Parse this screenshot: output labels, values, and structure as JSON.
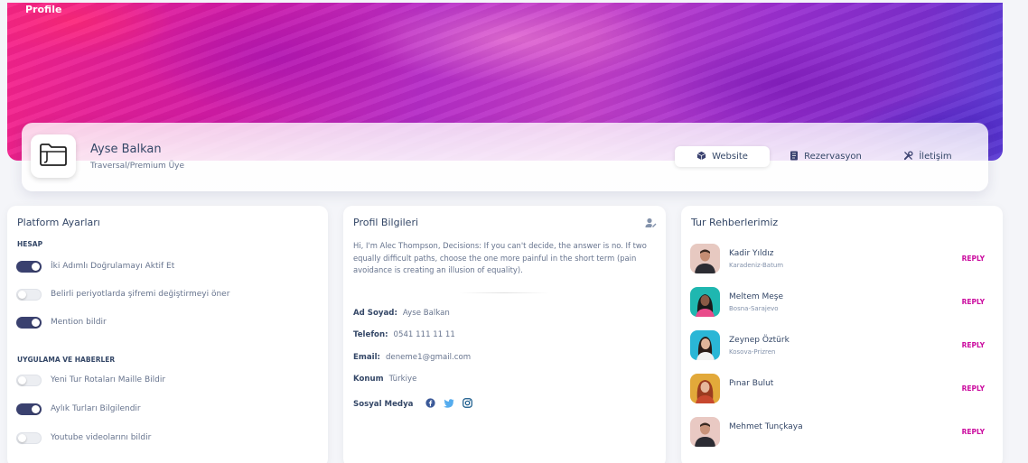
{
  "hero": {
    "title": "Profile"
  },
  "profile": {
    "name": "Ayse Balkan",
    "subtitle": "Traversal/Premium Üye",
    "avatar_icon": "folder-icon",
    "tabs": [
      {
        "label": "Website",
        "icon": "cube-icon",
        "active": true
      },
      {
        "label": "Rezervasyon",
        "icon": "document-icon",
        "active": false
      },
      {
        "label": "İletişim",
        "icon": "tools-icon",
        "active": false
      }
    ]
  },
  "settings": {
    "title": "Platform Ayarları",
    "sections": [
      {
        "label": "HESAP",
        "items": [
          {
            "label": "İki Adımlı Doğrulamayı Aktif Et",
            "on": true
          },
          {
            "label": "Belirli periyotlarda şifremi değiştirmeyi öner",
            "on": false
          },
          {
            "label": "Mention bildir",
            "on": true
          }
        ]
      },
      {
        "label": "UYGULAMA VE HABERLER",
        "items": [
          {
            "label": "Yeni Tur Rotaları Maille Bildir",
            "on": false
          },
          {
            "label": "Aylık Turları Bilgilendir",
            "on": true
          },
          {
            "label": "Youtube videolarını bildir",
            "on": false
          }
        ]
      }
    ]
  },
  "info": {
    "title": "Profil Bilgileri",
    "bio": "Hi, I'm Alec Thompson, Decisions: If you can't decide, the answer is no. If two equally difficult paths, choose the one more painful in the short term (pain avoidance is creating an illusion of equality).",
    "fields": [
      {
        "label": "Ad Soyad:",
        "value": "Ayse Balkan"
      },
      {
        "label": "Telefon:",
        "value": "0541 111 11 11"
      },
      {
        "label": "Email:",
        "value": "deneme1@gmail.com"
      },
      {
        "label": "Konum",
        "value": "Türkiye"
      }
    ],
    "social_label": "Sosyal Medya",
    "social_icons": [
      "facebook-icon",
      "twitter-icon",
      "instagram-icon"
    ],
    "colors": {
      "facebook": "#3b5998",
      "twitter": "#55acee",
      "instagram": "#125688"
    }
  },
  "guides": {
    "title": "Tur Rehberlerimiz",
    "reply_label": "REPLY",
    "items": [
      {
        "name": "Kadir Yıldız",
        "place": "Karadeniz-Batum",
        "bg": "#e7c9c1"
      },
      {
        "name": "Meltem Meşe",
        "place": "Bosna-Sarajevo",
        "bg": "#1fb7b0"
      },
      {
        "name": "Zeynep Öztürk",
        "place": "Kosova-Prizren",
        "bg": "#2ab6d6"
      },
      {
        "name": "Pınar Bulut",
        "place": "",
        "bg": "#e2a93a"
      },
      {
        "name": "Mehmet Tunçkaya",
        "place": "",
        "bg": "#e9c9c3"
      }
    ]
  },
  "colors": {
    "accent": "#cb0c9f",
    "toggle_on": "#3a416f",
    "text": "#344767",
    "muted": "#67748e"
  }
}
